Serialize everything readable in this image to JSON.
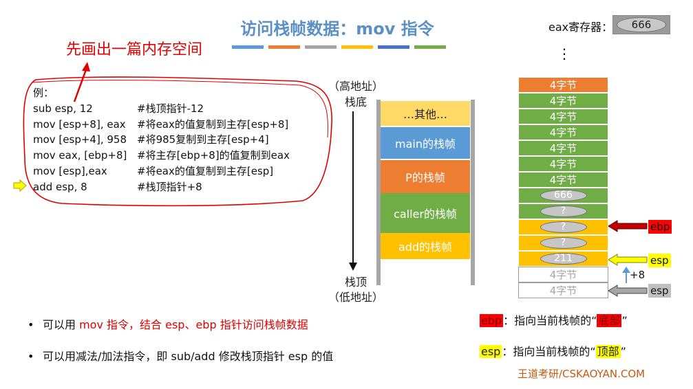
{
  "slide": {
    "title": "访问栈帧数据：mov 指令",
    "title_bar_colors": [
      "#5b9bd5",
      "#ed7d31",
      "#a5a5a5",
      "#ffc000",
      "#4472c4",
      "#70ad47"
    ],
    "hint": "先画出一篇内存空间"
  },
  "eax": {
    "label": "eax寄存器：",
    "value": "666"
  },
  "code": {
    "heading": "例：",
    "lines": [
      {
        "ins": "sub esp, 12",
        "comment": "#栈顶指针-12"
      },
      {
        "ins": "mov [esp+8], eax",
        "comment": "#将eax的值复制到主存[esp+8]"
      },
      {
        "ins": "mov [esp+4], 958",
        "comment": "#将985复制到主存[esp+4]"
      },
      {
        "ins": "mov eax, [ebp+8]",
        "comment": "#将主存[ebp+8]的值复制到eax"
      },
      {
        "ins": "mov [esp],eax",
        "comment": " #将eax的值复制到主存[esp]"
      },
      {
        "ins": "add esp, 8",
        "comment": "#栈顶指针+8"
      }
    ],
    "current_line_index": 5
  },
  "stack": {
    "top_label_1": "（高地址）",
    "top_label_2": "栈底",
    "bottom_label_1": "栈顶",
    "bottom_label_2": "（低地址）",
    "frames": [
      {
        "label": "…其他…",
        "color": "#ffd966",
        "text_color": "#222222"
      },
      {
        "label": "main的栈帧",
        "color": "#5b9bd5",
        "text_color": "#ffffff"
      },
      {
        "label": "P的栈帧",
        "color": "#ed7d31",
        "text_color": "#ffffff"
      },
      {
        "label": "caller的栈帧",
        "color": "#70ad47",
        "text_color": "#ffffff"
      },
      {
        "label": "add的栈帧",
        "color": "#ffc000",
        "text_color": "#ffffff"
      }
    ]
  },
  "memory": {
    "ellipsis": "⋮",
    "cells": [
      {
        "kind": "orange",
        "text": "4字节"
      },
      {
        "kind": "green",
        "text": "4字节"
      },
      {
        "kind": "green",
        "text": "4字节"
      },
      {
        "kind": "green",
        "text": "4字节"
      },
      {
        "kind": "green",
        "text": "4字节"
      },
      {
        "kind": "green",
        "text": "4字节"
      },
      {
        "kind": "green",
        "text": "4字节"
      },
      {
        "kind": "green",
        "oval": "666"
      },
      {
        "kind": "green",
        "oval": "?"
      },
      {
        "kind": "yellow",
        "oval": "?"
      },
      {
        "kind": "yellow",
        "oval": "?"
      },
      {
        "kind": "yellow",
        "oval": "211"
      },
      {
        "kind": "white",
        "text": "4字节"
      },
      {
        "kind": "white",
        "text": "4字节"
      }
    ]
  },
  "registers": {
    "ebp": {
      "label": "ebp",
      "color": "#ff0000"
    },
    "esp": {
      "label": "esp",
      "color": "#ffff00"
    },
    "esp_old": {
      "label": "esp",
      "color": "#bfbfbf"
    },
    "offset": "+8"
  },
  "bullets": [
    {
      "pre": "可以用 ",
      "red": "mov 指令，结合 esp、ebp 指针访问栈帧数据",
      "post": ""
    },
    {
      "pre": "可以用减法/加法指令，即 sub/add 修改栈顶指针 esp 的值",
      "red": "",
      "post": ""
    }
  ],
  "legend": {
    "ebp": {
      "reg": "ebp",
      "text": "：指向当前栈帧的“",
      "keyword": "底部",
      "end": "”"
    },
    "esp": {
      "reg": "esp",
      "text": "：指向当前栈帧的“",
      "keyword": "顶部",
      "end": "”"
    }
  },
  "footer": "王道考研/CSKAOYAN.COM"
}
